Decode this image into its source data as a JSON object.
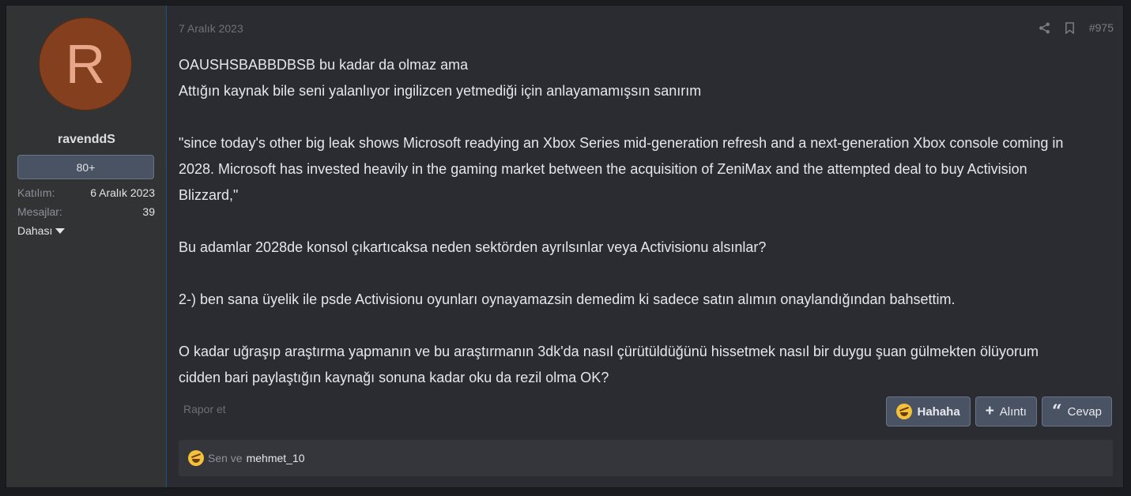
{
  "user": {
    "avatar_letter": "R",
    "name": "ravenddS",
    "badge": "80+",
    "joined_label": "Katılım:",
    "joined_value": "6 Aralık 2023",
    "messages_label": "Mesajlar:",
    "messages_value": "39",
    "more_label": "Dahası"
  },
  "post": {
    "date": "7 Aralık 2023",
    "number": "#975",
    "lines": [
      "OAUSHSBABBDBSB bu kadar da olmaz ama",
      "Attığın kaynak bile seni yalanlıyor ingilizcen yetmediği için anlayamamışsın sanırım",
      "",
      "\"since today's other big leak shows Microsoft readying an Xbox Series mid-generation refresh and a next-generation Xbox console coming in",
      "2028. Microsoft has invested heavily in the gaming market between the acquisition of ZeniMax and the attempted deal to buy Activision",
      "Blizzard,\"",
      "",
      "Bu adamlar 2028de konsol çıkartıcaksa neden sektörden ayrılsınlar veya Activisionu alsınlar?",
      "",
      "2-) ben sana üyelik ile psde Activisionu oyunları oynayamazsin demedim ki sadece satın alımın onaylandığından bahsettim.",
      "",
      "O kadar uğraşıp araştırma yapmanın ve bu araştırmanın 3dk'da nasıl çürütüldüğünü hissetmek nasıl bir duygu şuan gülmekten ölüyorum",
      "cidden bari paylaştığın kaynağı sonuna kadar oku da rezil olma OK?"
    ],
    "report_label": "Rapor et",
    "reaction_button": "Hahaha",
    "quote_button": "Alıntı",
    "reply_button": "Cevap",
    "reactions_you": "Sen ve",
    "reactions_user": "mehmet_10"
  },
  "icons": {
    "share": "share-icon",
    "bookmark": "bookmark-icon",
    "reaction": "laughing-emoji-icon",
    "plus": "plus-icon",
    "quote": "quote-icon",
    "caret": "caret-down-icon"
  },
  "colors": {
    "accent_border": "#1d4f80",
    "avatar_bg": "#843f1f",
    "button_bg": "#4a5363"
  }
}
